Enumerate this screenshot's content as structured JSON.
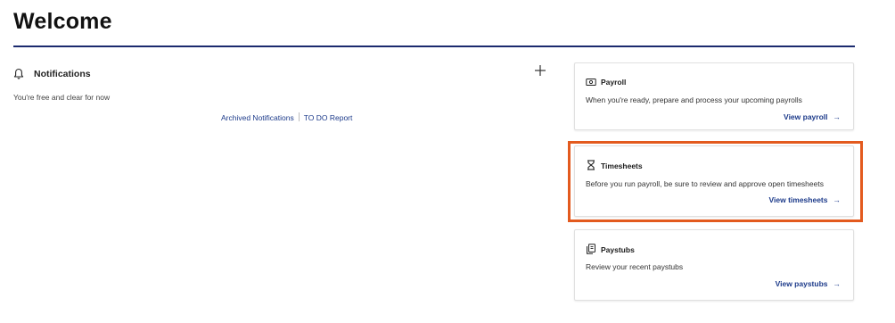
{
  "page": {
    "title": "Welcome"
  },
  "notifications": {
    "title": "Notifications",
    "icon": "bell-icon",
    "add_icon": "plus-icon",
    "empty_message": "You're free and clear for now",
    "links": {
      "archived": "Archived Notifications",
      "todo": "TO DO Report"
    }
  },
  "cards": {
    "payroll": {
      "icon": "money-icon",
      "title": "Payroll",
      "description": "When you're ready, prepare and process your upcoming payrolls",
      "link": "View payroll",
      "arrow": "→"
    },
    "timesheets": {
      "icon": "hourglass-icon",
      "title": "Timesheets",
      "description": "Before you run payroll, be sure to review and approve open timesheets",
      "link": "View timesheets",
      "arrow": "→"
    },
    "paystubs": {
      "icon": "documents-icon",
      "title": "Paystubs",
      "description": "Review your recent paystubs",
      "link": "View paystubs",
      "arrow": "→"
    }
  },
  "colors": {
    "title_rule": "#1b2a6e",
    "link": "#1c3a8a",
    "highlight": "#e35a1e"
  }
}
